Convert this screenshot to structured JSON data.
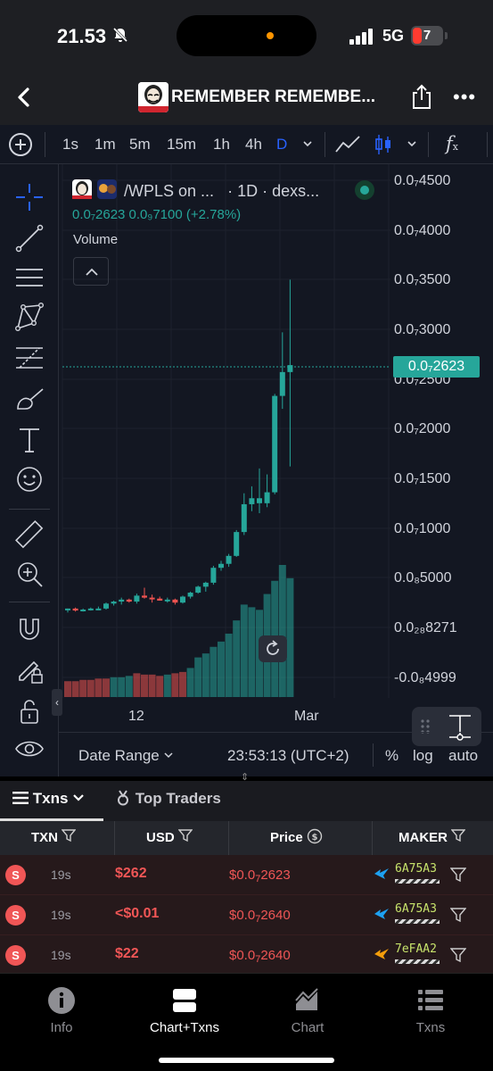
{
  "status_bar": {
    "time": "21.53",
    "network": "5G",
    "battery": "7"
  },
  "header": {
    "title": "REMEMBER REMEMBE..."
  },
  "timeframes": [
    {
      "label": "1s",
      "active": false
    },
    {
      "label": "1m",
      "active": false
    },
    {
      "label": "5m",
      "active": false
    },
    {
      "label": "15m",
      "active": false
    },
    {
      "label": "1h",
      "active": false
    },
    {
      "label": "4h",
      "active": false
    },
    {
      "label": "D",
      "active": true
    }
  ],
  "chart": {
    "legend_pair": "/WPLS on ...",
    "legend_interval": "· 1D · dexs...",
    "legend_values": "0.0₇2623  0.0₉7100 (+2.78%)",
    "volume_label": "Volume",
    "price_axis": [
      "0.0₇4500",
      "0.0₇4000",
      "0.0₇3500",
      "0.0₇3000",
      "0.0₇2500",
      "0.0₇2000",
      "0.0₇1500",
      "0.0₇1000",
      "0.0₈5000",
      "0.0₂₈8271",
      "-0.0₈4999"
    ],
    "current_price": "0.0₇2623",
    "date_labels": [
      "12",
      "Mar"
    ],
    "date_range": "Date Range",
    "clock": "23:53:13 (UTC+2)",
    "options": [
      "%",
      "log",
      "auto"
    ]
  },
  "chart_data": {
    "type": "candlestick",
    "ylim": [
      0,
      4.5e-08
    ],
    "candles": [
      [
        1.8e-09,
        1.9e-09,
        1.5e-09,
        1.9e-09,
        1
      ],
      [
        1.9e-09,
        2e-09,
        1.6e-09,
        1.7e-09,
        0
      ],
      [
        1.7e-09,
        1.9e-09,
        1.6e-09,
        1.8e-09,
        1
      ],
      [
        1.8e-09,
        2e-09,
        1.7e-09,
        1.9e-09,
        1
      ],
      [
        1.9e-09,
        2.1e-09,
        1.8e-09,
        1.9e-09,
        1
      ],
      [
        1.9e-09,
        2.5e-09,
        1.8e-09,
        2.4e-09,
        1
      ],
      [
        2.4e-09,
        2.7e-09,
        2.2e-09,
        2.6e-09,
        1
      ],
      [
        2.6e-09,
        3e-09,
        2.3e-09,
        2.8e-09,
        1
      ],
      [
        2.8e-09,
        2.9e-09,
        2.5e-09,
        2.6e-09,
        0
      ],
      [
        2.6e-09,
        3.4e-09,
        2.4e-09,
        3.2e-09,
        1
      ],
      [
        3.2e-09,
        4e-09,
        2.9e-09,
        3e-09,
        0
      ],
      [
        3e-09,
        3.3e-09,
        2.5e-09,
        2.9e-09,
        0
      ],
      [
        2.9e-09,
        3.1e-09,
        2.7e-09,
        2.7e-09,
        0
      ],
      [
        2.7e-09,
        3e-09,
        2.5e-09,
        2.8e-09,
        1
      ],
      [
        2.8e-09,
        2.9e-09,
        2.3e-09,
        2.5e-09,
        0
      ],
      [
        2.5e-09,
        3.2e-09,
        2.4e-09,
        3.1e-09,
        1
      ],
      [
        3.1e-09,
        3.6e-09,
        2.9e-09,
        3.5e-09,
        1
      ],
      [
        3.5e-09,
        4.2e-09,
        3.4e-09,
        4.1e-09,
        1
      ],
      [
        4.1e-09,
        4.6e-09,
        3.6e-09,
        4.5e-09,
        1
      ],
      [
        4.5e-09,
        6.2e-09,
        4.3e-09,
        6e-09,
        1
      ],
      [
        6e-09,
        6.7e-09,
        5.7e-09,
        6.4e-09,
        1
      ],
      [
        6.4e-09,
        7.4e-09,
        6.1e-09,
        7.2e-09,
        1
      ],
      [
        7.2e-09,
        9.8e-09,
        7.1e-09,
        9.6e-09,
        1
      ],
      [
        9.6e-09,
        1.35e-08,
        9.3e-09,
        1.24e-08,
        1
      ],
      [
        1.24e-08,
        1.42e-08,
        1.17e-08,
        1.3e-08,
        1
      ],
      [
        1.3e-08,
        1.6e-08,
        1.15e-08,
        1.25e-08,
        1
      ],
      [
        1.25e-08,
        1.54e-08,
        1.21e-08,
        1.36e-08,
        1
      ],
      [
        1.36e-08,
        2.35e-08,
        1.34e-08,
        2.33e-08,
        1
      ],
      [
        2.33e-08,
        2.97e-08,
        2.2e-08,
        2.57e-08,
        1
      ],
      [
        2.57e-08,
        3.5e-08,
        1.62e-08,
        2.64e-08,
        1
      ]
    ],
    "volumes": [
      [
        0.12,
        0
      ],
      [
        0.12,
        0
      ],
      [
        0.13,
        0
      ],
      [
        0.13,
        0
      ],
      [
        0.14,
        0
      ],
      [
        0.14,
        0
      ],
      [
        0.15,
        1
      ],
      [
        0.15,
        1
      ],
      [
        0.16,
        1
      ],
      [
        0.18,
        0
      ],
      [
        0.17,
        0
      ],
      [
        0.17,
        0
      ],
      [
        0.16,
        0
      ],
      [
        0.17,
        1
      ],
      [
        0.18,
        0
      ],
      [
        0.19,
        0
      ],
      [
        0.22,
        1
      ],
      [
        0.3,
        1
      ],
      [
        0.33,
        1
      ],
      [
        0.38,
        1
      ],
      [
        0.42,
        1
      ],
      [
        0.48,
        1
      ],
      [
        0.58,
        1
      ],
      [
        0.7,
        1
      ],
      [
        0.68,
        1
      ],
      [
        0.66,
        1
      ],
      [
        0.78,
        1
      ],
      [
        0.88,
        1
      ],
      [
        1.0,
        1
      ],
      [
        0.9,
        1
      ]
    ]
  },
  "tabs": {
    "txns": "Txns",
    "top_traders": "Top Traders"
  },
  "table": {
    "headers": [
      "TXN",
      "USD",
      "Price",
      "MAKER"
    ],
    "rows": [
      {
        "type": "S",
        "age": "19s",
        "usd": "$262",
        "price_pre": "$0.0",
        "price_sub": "7",
        "price_post": "2623",
        "maker": "6A75A3",
        "maker_color": "#1da1f2"
      },
      {
        "type": "S",
        "age": "19s",
        "usd": "<$0.01",
        "price_pre": "$0.0",
        "price_sub": "7",
        "price_post": "2640",
        "maker": "6A75A3",
        "maker_color": "#1da1f2"
      },
      {
        "type": "S",
        "age": "19s",
        "usd": "$22",
        "price_pre": "$0.0",
        "price_sub": "7",
        "price_post": "2640",
        "maker": "7eFAA2",
        "maker_color": "#f59e0b"
      }
    ]
  },
  "bottom_nav": [
    {
      "label": "Info",
      "active": false
    },
    {
      "label": "Chart+Txns",
      "active": true
    },
    {
      "label": "Chart",
      "active": false
    },
    {
      "label": "Txns",
      "active": false
    }
  ],
  "colors": {
    "up": "#26a69a",
    "down": "#ef5350",
    "bg": "#131722",
    "sell": "#f05656"
  }
}
